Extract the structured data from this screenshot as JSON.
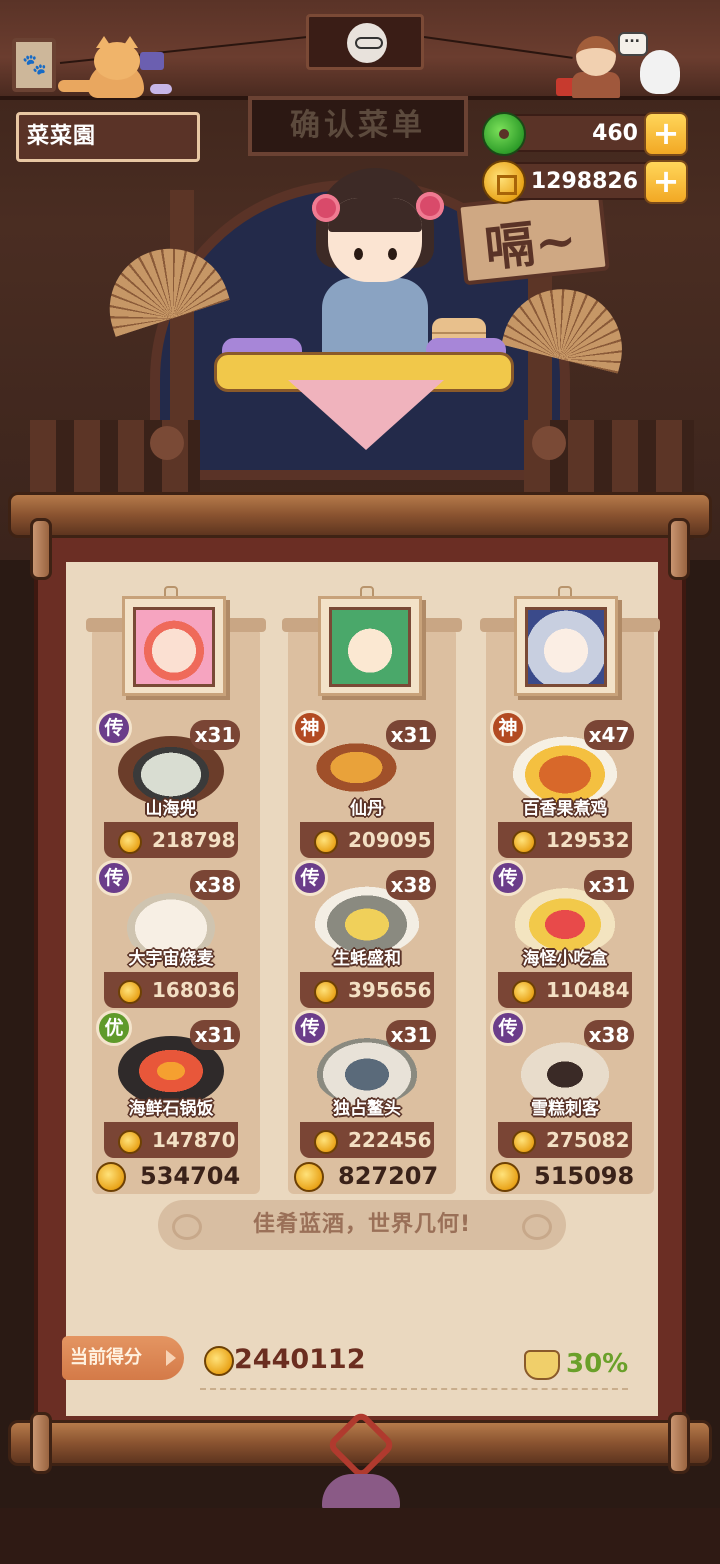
{
  "header": {
    "username": "菜菜園",
    "menu_sign": "确认菜单",
    "jade_amount": "460",
    "gold_amount": "1298826",
    "shout": "嗝~"
  },
  "columns": [
    {
      "portrait": "hero-portrait-1",
      "total": "534704",
      "dishes": [
        {
          "tier": "传",
          "tier_color": "#6b3d8a",
          "qty": "x31",
          "name": "山海兜",
          "price": "218798"
        },
        {
          "tier": "传",
          "tier_color": "#6b3d8a",
          "qty": "x38",
          "name": "大宇宙烧麦",
          "price": "168036"
        },
        {
          "tier": "优",
          "tier_color": "#5f9a2a",
          "qty": "x31",
          "name": "海鲜石锅饭",
          "price": "147870"
        }
      ]
    },
    {
      "portrait": "hero-portrait-2",
      "total": "827207",
      "dishes": [
        {
          "tier": "神",
          "tier_color": "#b24a22",
          "qty": "x31",
          "name": "仙丹",
          "price": "209095"
        },
        {
          "tier": "传",
          "tier_color": "#6b3d8a",
          "qty": "x38",
          "name": "生蚝盛和",
          "price": "395656"
        },
        {
          "tier": "传",
          "tier_color": "#6b3d8a",
          "qty": "x31",
          "name": "独占鳌头",
          "price": "222456"
        }
      ]
    },
    {
      "portrait": "hero-portrait-3",
      "total": "515098",
      "dishes": [
        {
          "tier": "神",
          "tier_color": "#b24a22",
          "qty": "x47",
          "name": "百香果煮鸡",
          "price": "129532"
        },
        {
          "tier": "传",
          "tier_color": "#6b3d8a",
          "qty": "x31",
          "name": "海怪小吃盒",
          "price": "110484"
        },
        {
          "tier": "传",
          "tier_color": "#6b3d8a",
          "qty": "x38",
          "name": "雪糕刺客",
          "price": "275082"
        }
      ]
    }
  ],
  "slogan": "佳肴蓝酒，世界几何!",
  "score": {
    "label": "当前得分",
    "value": "2440112",
    "bonus": "30%"
  }
}
